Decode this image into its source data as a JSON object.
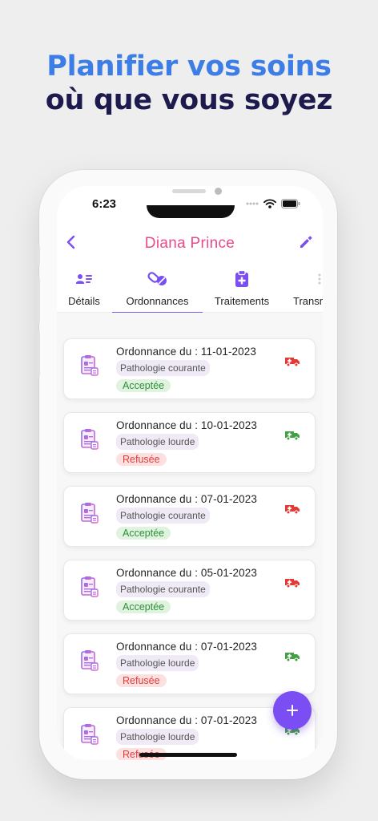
{
  "headline": {
    "line1": "Planifier vos soins",
    "line2": "où que vous soyez"
  },
  "status_bar": {
    "time": "6:23"
  },
  "header": {
    "title": "Diana Prince"
  },
  "tabs": [
    {
      "label": "Détails",
      "icon": "contact-card-icon",
      "active": false
    },
    {
      "label": "Ordonnances",
      "icon": "pills-icon",
      "active": true
    },
    {
      "label": "Traitements",
      "icon": "clipboard-plus-icon",
      "active": false
    },
    {
      "label": "Transm",
      "icon": "more-icon",
      "active": false
    }
  ],
  "prescriptions": [
    {
      "title": "Ordonnance du : 11-01-2023",
      "pathology": "Pathologie courante",
      "status": "Acceptée",
      "status_type": "accepted",
      "transport_color": "#e53935"
    },
    {
      "title": "Ordonnance du : 10-01-2023",
      "pathology": "Pathologie lourde",
      "status": "Refusée",
      "status_type": "refused",
      "transport_color": "#43a047"
    },
    {
      "title": "Ordonnance du : 07-01-2023",
      "pathology": "Pathologie courante",
      "status": "Acceptée",
      "status_type": "accepted",
      "transport_color": "#e53935"
    },
    {
      "title": "Ordonnance du : 05-01-2023",
      "pathology": "Pathologie courante",
      "status": "Acceptée",
      "status_type": "accepted",
      "transport_color": "#e53935"
    },
    {
      "title": "Ordonnance du : 07-01-2023",
      "pathology": "Pathologie lourde",
      "status": "Refusée",
      "status_type": "refused",
      "transport_color": "#43a047"
    },
    {
      "title": "Ordonnance du : 07-01-2023",
      "pathology": "Pathologie lourde",
      "status": "Refusée",
      "status_type": "refused",
      "transport_color": "#43a047"
    }
  ],
  "colors": {
    "accent": "#7a4ef2",
    "title": "#e84b8a",
    "headline_blue": "#3d7ee6",
    "headline_dark": "#1d1b4d"
  }
}
